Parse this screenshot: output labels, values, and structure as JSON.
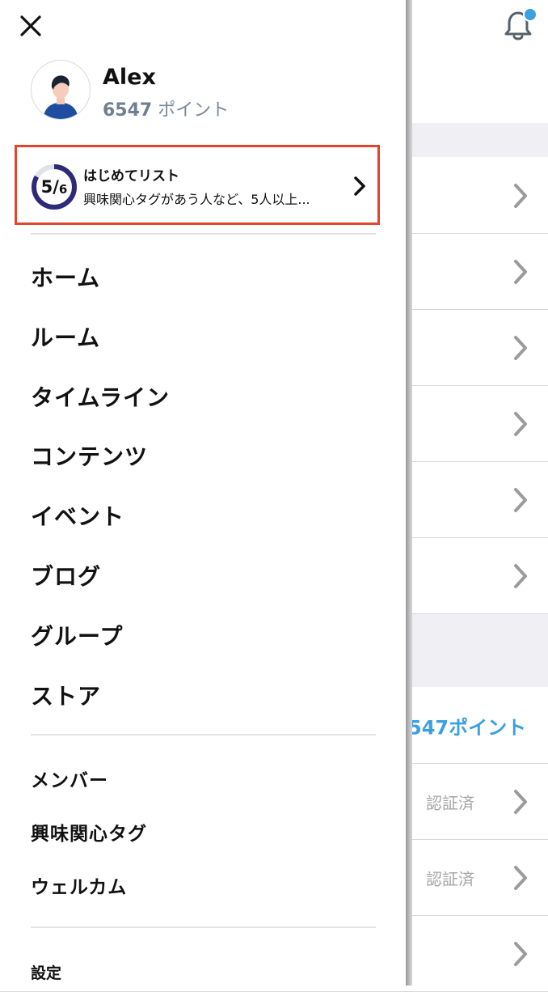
{
  "background": {
    "points_text": "547ポイント",
    "verified_label_1": "認証済",
    "verified_label_2": "認証済",
    "notification_icon": "bell-icon",
    "has_unread": true
  },
  "drawer": {
    "close_icon": "close-icon",
    "profile": {
      "name": "Alex",
      "points_value": "6547",
      "points_unit": "ポイント"
    },
    "starter_list": {
      "progress_done": "5",
      "progress_total": "6",
      "progress_fraction": 0.833,
      "title": "はじめてリスト",
      "description": "興味関心タグがあう人など、5人以上...",
      "highlight_color": "#e2442c"
    },
    "main_nav": [
      {
        "label": "ホーム"
      },
      {
        "label": "ルーム"
      },
      {
        "label": "タイムライン"
      },
      {
        "label": "コンテンツ"
      },
      {
        "label": "イベント"
      },
      {
        "label": "ブログ"
      },
      {
        "label": "グループ"
      },
      {
        "label": "ストア"
      }
    ],
    "secondary_nav": [
      {
        "label": "メンバー"
      },
      {
        "label": "興味関心タグ"
      },
      {
        "label": "ウェルカム"
      }
    ],
    "settings_label": "設定"
  },
  "colors": {
    "accent": "#3ba0e0",
    "progress_ring": "#2e2a78",
    "highlight": "#e2442c"
  }
}
